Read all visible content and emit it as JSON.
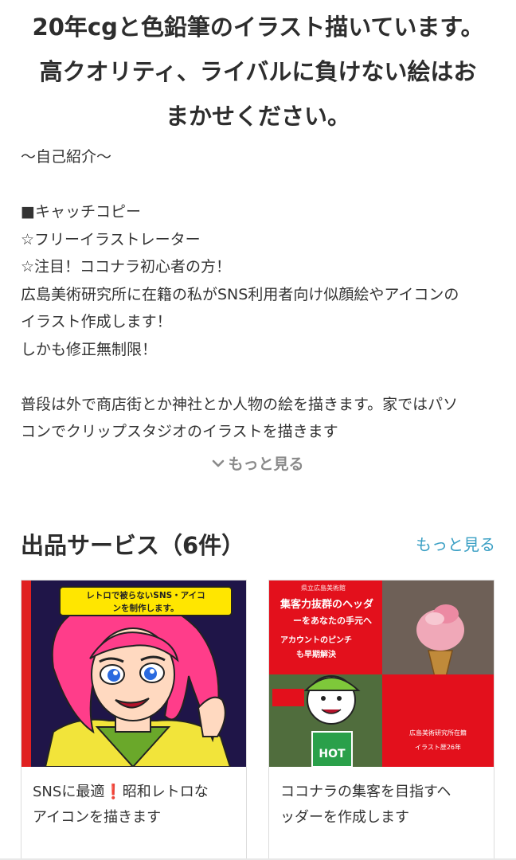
{
  "headline": {
    "line1": "20年cgと色鉛筆のイラスト描いています。",
    "line2": "高クオリティ、ライバルに負けない絵はお",
    "line3": "まかせください。"
  },
  "intro": {
    "heading": "〜自己紹介〜",
    "catch_label": "■キャッチコピー",
    "star1": "☆フリーイラストレーター",
    "star2": "☆注目！ココナラ初心者の方！",
    "p1_line1": "広島美術研究所に在籍の私がSNS利用者向け似顔絵やアイコンの",
    "p1_line2": "イラスト作成します！",
    "p1_line3": "しかも修正無制限！",
    "p2_line1": "普段は外で商店街とか神社とか人物の絵を描きます。家ではパソ",
    "p2_line2": "コンでクリップスタジオのイラストを描きます"
  },
  "more_toggle": {
    "label": "もっと見る",
    "icon": "chevron-down-icon"
  },
  "services": {
    "title": "出品サービス（6件）",
    "more_link": "もっと見る",
    "cards": [
      {
        "banner_line1": "レトロで被らないSNS・アイコ",
        "banner_line2": "ンを制作します。",
        "title_part1": "SNSに最適",
        "title_mark": "❗",
        "title_part2": "昭和レトロな",
        "title_line2": "アイコンを描きます"
      },
      {
        "tag": "県立広島美術館",
        "banner_line1": "集客力抜群のヘッダ",
        "banner_line2": "ーをあなたの手元へ",
        "banner_line3": "アカウントのピンチ",
        "banner_line4": "も早期解決",
        "shop_sign": "HOT",
        "footer_line1": "広島美術研究所在籍",
        "footer_line2": "イラスト歴26年",
        "title_line1": "ココナラの集客を目指すヘ",
        "title_line2": "ッダーを作成します"
      }
    ]
  },
  "colors": {
    "text": "#333333",
    "link": "#3a9fc4",
    "muted": "#8a8a8a",
    "accent_red": "#e02020",
    "banner_yellow": "#ffe600"
  }
}
